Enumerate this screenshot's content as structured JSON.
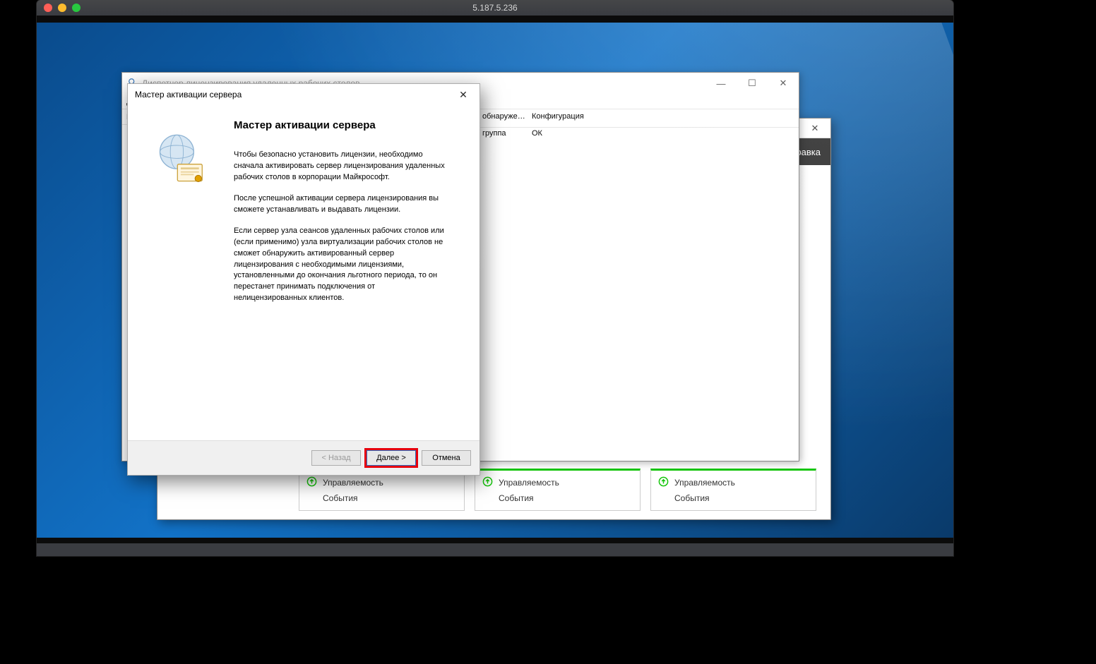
{
  "mac": {
    "title": "5.187.5.236"
  },
  "server_manager": {
    "menu_item": "правка",
    "tile1": {
      "line1": "Управляемость",
      "line2": "События"
    },
    "tile2": {
      "line1": "Управляемость",
      "line2": "События"
    },
    "tile3": {
      "line1": "Управляемость",
      "line2": "События"
    }
  },
  "license_manager": {
    "window_title": "Диспетчер лицензирования удаленных рабочих столов",
    "columns": {
      "last": "обнаруже…",
      "config": "Конфигурация"
    },
    "row": {
      "group": "группа",
      "status": "ОК"
    }
  },
  "wizard": {
    "window_title": "Мастер активации сервера",
    "heading": "Мастер активации сервера",
    "para1": "Чтобы безопасно установить лицензии, необходимо сначала активировать сервер лицензирования удаленных рабочих столов в корпорации Майкрософт.",
    "para2": "После успешной активации сервера лицензирования вы сможете устанавливать и выдавать лицензии.",
    "para3": "Если сервер узла сеансов удаленных рабочих столов или (если применимо) узла виртуализации рабочих столов не сможет обнаружить активированный сервер лицензирования с необходимыми лицензиями, установленными до окончания льготного периода, то он перестанет принимать подключения от нелицензированных клиентов.",
    "btn_back": "< Назад",
    "btn_next": "Далее >",
    "btn_cancel": "Отмена"
  }
}
